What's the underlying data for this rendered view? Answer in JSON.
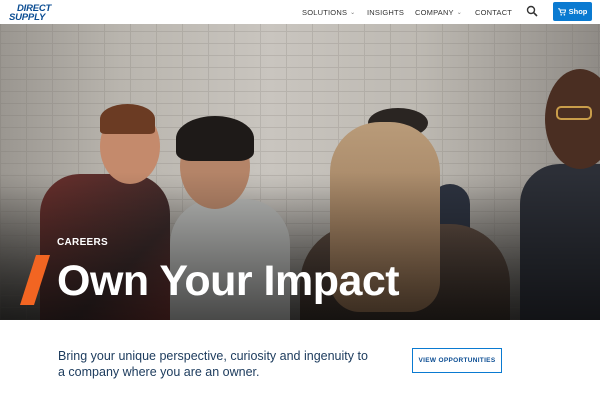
{
  "header": {
    "logo_line1": "DIRECT",
    "logo_line2": "SUPPLY",
    "nav": [
      {
        "label": "SOLUTIONS",
        "has_dropdown": true
      },
      {
        "label": "INSIGHTS",
        "has_dropdown": false
      },
      {
        "label": "COMPANY",
        "has_dropdown": true
      },
      {
        "label": "CONTACT",
        "has_dropdown": false
      }
    ],
    "search_icon": "search-icon",
    "shop_label": "Shop",
    "shop_icon": "cart-icon"
  },
  "hero": {
    "eyebrow": "CAREERS",
    "headline": "Own Your Impact",
    "accent_color": "#f26522"
  },
  "intro": {
    "text": "Bring your unique perspective, curiosity and ingenuity to a company where you are an owner.",
    "cta_label": "VIEW OPPORTUNITIES"
  },
  "colors": {
    "brand_blue": "#0b4d93",
    "button_blue": "#0a7ad1",
    "text_navy": "#1b3a5c"
  }
}
